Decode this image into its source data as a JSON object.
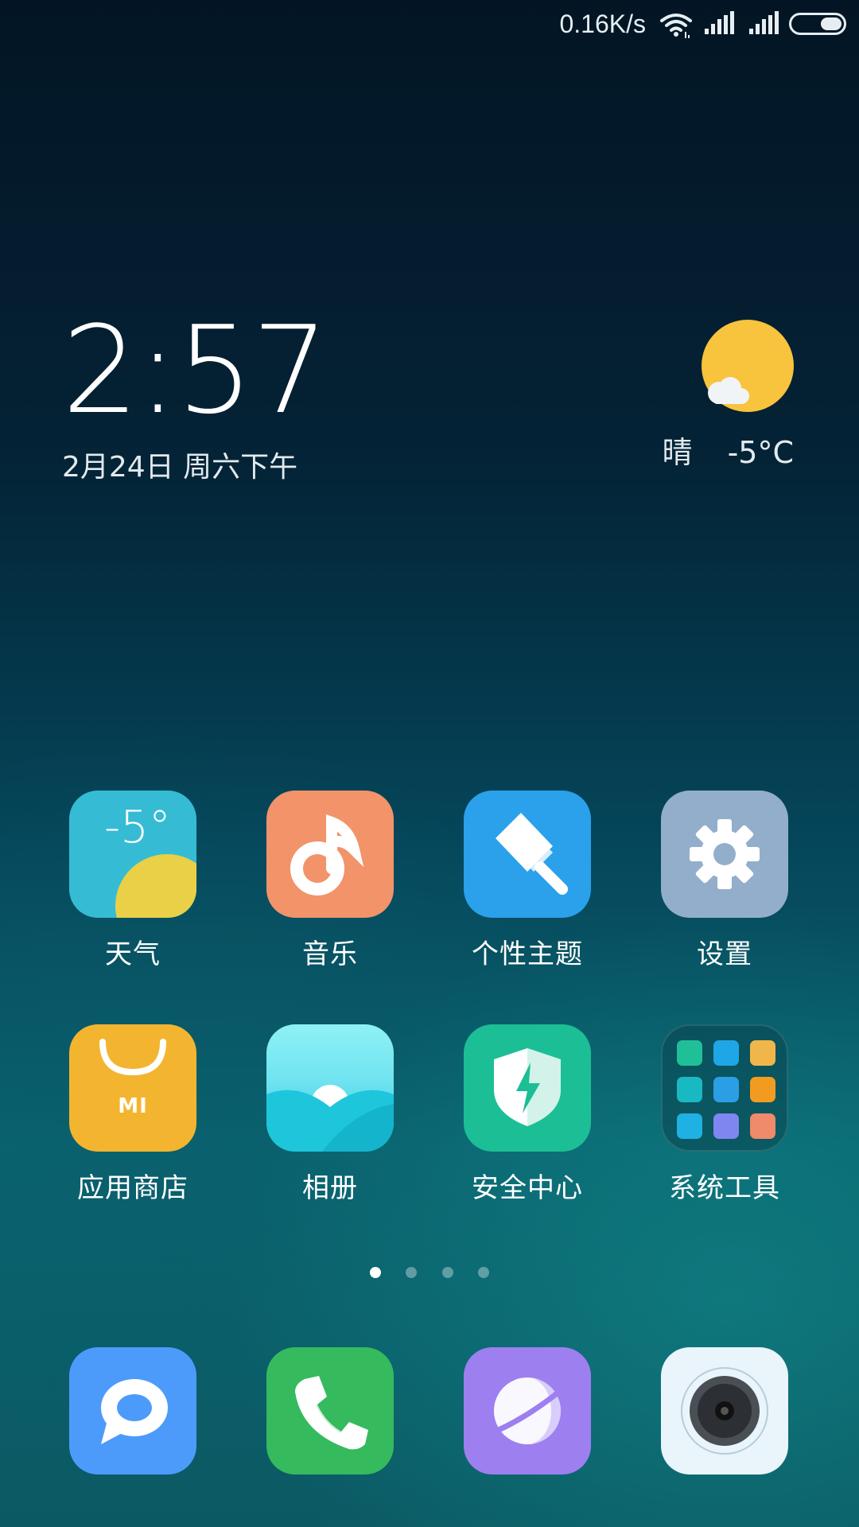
{
  "status_bar": {
    "net_speed": "0.16K/s",
    "icons": [
      "wifi-icon",
      "signal-1-icon",
      "signal-2-icon",
      "battery-icon"
    ]
  },
  "clock_widget": {
    "time": "2:57",
    "date": "2月24日 周六下午"
  },
  "weather_widget": {
    "condition": "晴",
    "temperature": "-5°C",
    "icon": "sunny-cloud-icon"
  },
  "apps": [
    {
      "label": "天气",
      "icon": "weather-icon",
      "badge_temp": "-5°",
      "color": "#35bcd4"
    },
    {
      "label": "音乐",
      "icon": "music-icon",
      "color": "#f2936a"
    },
    {
      "label": "个性主题",
      "icon": "themes-brush-icon",
      "color": "#2aa1ea"
    },
    {
      "label": "设置",
      "icon": "settings-gear-icon",
      "color": "#93aecb"
    },
    {
      "label": "应用商店",
      "icon": "app-store-bag-icon",
      "store_mark": "MI",
      "color": "#f3b52f"
    },
    {
      "label": "相册",
      "icon": "gallery-icon",
      "color": "#2bcce0"
    },
    {
      "label": "安全中心",
      "icon": "security-shield-icon",
      "color": "#1cbe96"
    },
    {
      "label": "系统工具",
      "icon": "folder-icon",
      "color": "#0f5a64"
    }
  ],
  "page_indicator": {
    "count": 4,
    "active_index": 0
  },
  "dock": [
    {
      "icon": "messages-icon",
      "color": "#4c9bfb"
    },
    {
      "icon": "phone-icon",
      "color": "#35ba5e"
    },
    {
      "icon": "browser-icon",
      "color": "#9d7ff0"
    },
    {
      "icon": "camera-icon",
      "color": "#e9f5fb"
    }
  ]
}
